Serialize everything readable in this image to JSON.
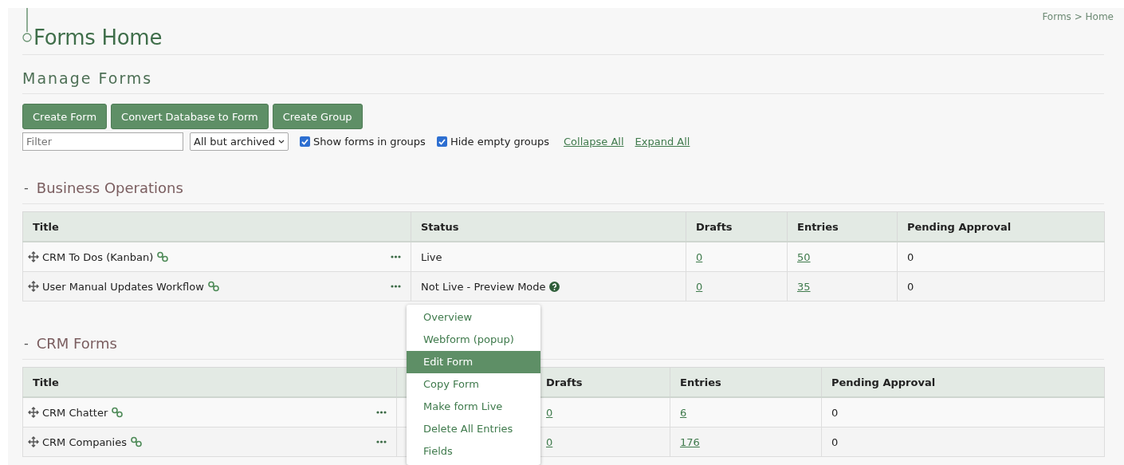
{
  "page": {
    "title": "Forms Home",
    "breadcrumb": "Forms > Home"
  },
  "section_title": "Manage Forms",
  "buttons": [
    "Create Form",
    "Convert Database to Form",
    "Create Group"
  ],
  "filter": {
    "placeholder": "Filter",
    "scope": "All but archived"
  },
  "options": [
    {
      "label": "Show forms in groups",
      "checked": true
    },
    {
      "label": "Hide empty groups",
      "checked": true
    }
  ],
  "links": [
    "Collapse All",
    "Expand All"
  ],
  "groups": [
    {
      "name": "Business Operations",
      "toggle": "-",
      "columns": [
        "Title",
        "Status",
        "Drafts",
        "Entries",
        "Pending Approval"
      ],
      "rows": [
        {
          "title": "CRM To Dos (Kanban)",
          "status": "Live",
          "status_help": false,
          "drafts": "0",
          "entries": "50",
          "pending_approval": "0"
        },
        {
          "title": "User Manual Updates Workflow",
          "status": "Not Live - Preview Mode",
          "status_help": true,
          "drafts": "0",
          "entries": "35",
          "pending_approval": "0"
        }
      ]
    },
    {
      "name": "CRM Forms",
      "toggle": "-",
      "columns": [
        "Title",
        null,
        "Drafts",
        "Entries",
        "Pending Approval"
      ],
      "rows": [
        {
          "title": "CRM Chatter",
          "drafts": "0",
          "entries": "6",
          "pending_approval": "0"
        },
        {
          "title": "CRM Companies",
          "drafts": "0",
          "entries": "176",
          "pending_approval": "0"
        }
      ]
    }
  ],
  "context_menu": {
    "items": [
      {
        "label": "Overview",
        "selected": false
      },
      {
        "label": "Webform (popup)",
        "selected": false
      },
      {
        "label": "Edit Form",
        "selected": true
      },
      {
        "label": "Copy Form",
        "selected": false
      },
      {
        "label": "Make form Live",
        "selected": false
      },
      {
        "label": "Delete All Entries",
        "selected": false
      },
      {
        "label": "Fields",
        "selected": false
      }
    ]
  }
}
